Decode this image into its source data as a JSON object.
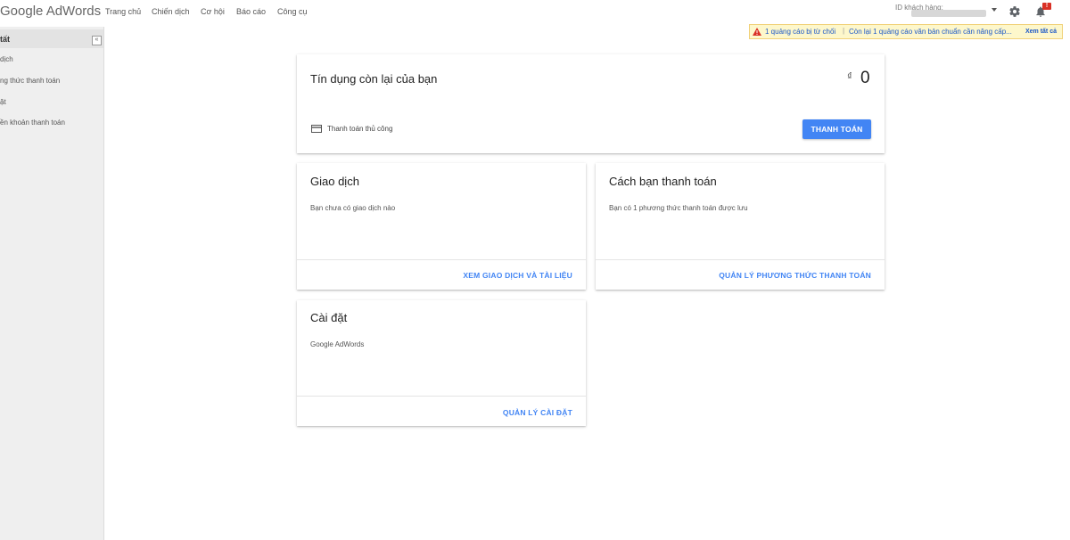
{
  "header": {
    "logo": "Google AdWords",
    "nav": [
      "Trang chủ",
      "Chiến dịch",
      "Cơ hội",
      "Báo cáo",
      "Công cụ"
    ],
    "customer_id_label": "ID khách hàng:",
    "notification_count": "!"
  },
  "alert": {
    "message1": "1 quảng cáo bị từ chối",
    "separator": "|",
    "message2": "Còn lại 1 quảng cáo văn bản chuẩn cần nâng cấp...",
    "view_all": "Xem tất cả"
  },
  "sidebar": {
    "header": "tất",
    "items": [
      "dịch",
      "ng thức thanh toán",
      "ặt",
      "ền khoản thanh toán"
    ]
  },
  "credit_card": {
    "title": "Tín dụng còn lại của bạn",
    "currency": "₫",
    "amount": "0",
    "payment_type": "Thanh toán thủ công",
    "pay_button": "THANH TOÁN"
  },
  "transactions_card": {
    "title": "Giao dịch",
    "text": "Bạn chưa có giao dịch nào",
    "link": "XEM GIAO DỊCH VÀ TÀI LIỆU"
  },
  "payment_methods_card": {
    "title": "Cách bạn thanh toán",
    "text": "Bạn có 1 phương thức thanh toán được lưu",
    "link": "QUẢN LÝ PHƯƠNG THỨC THANH TOÁN"
  },
  "settings_card": {
    "title": "Cài đặt",
    "text": "Google AdWords",
    "link": "QUẢN LÝ CÀI ĐẶT"
  },
  "colors": {
    "accent": "#4285f4",
    "alert_bg": "#fdf7cb",
    "badge": "#d93025"
  }
}
